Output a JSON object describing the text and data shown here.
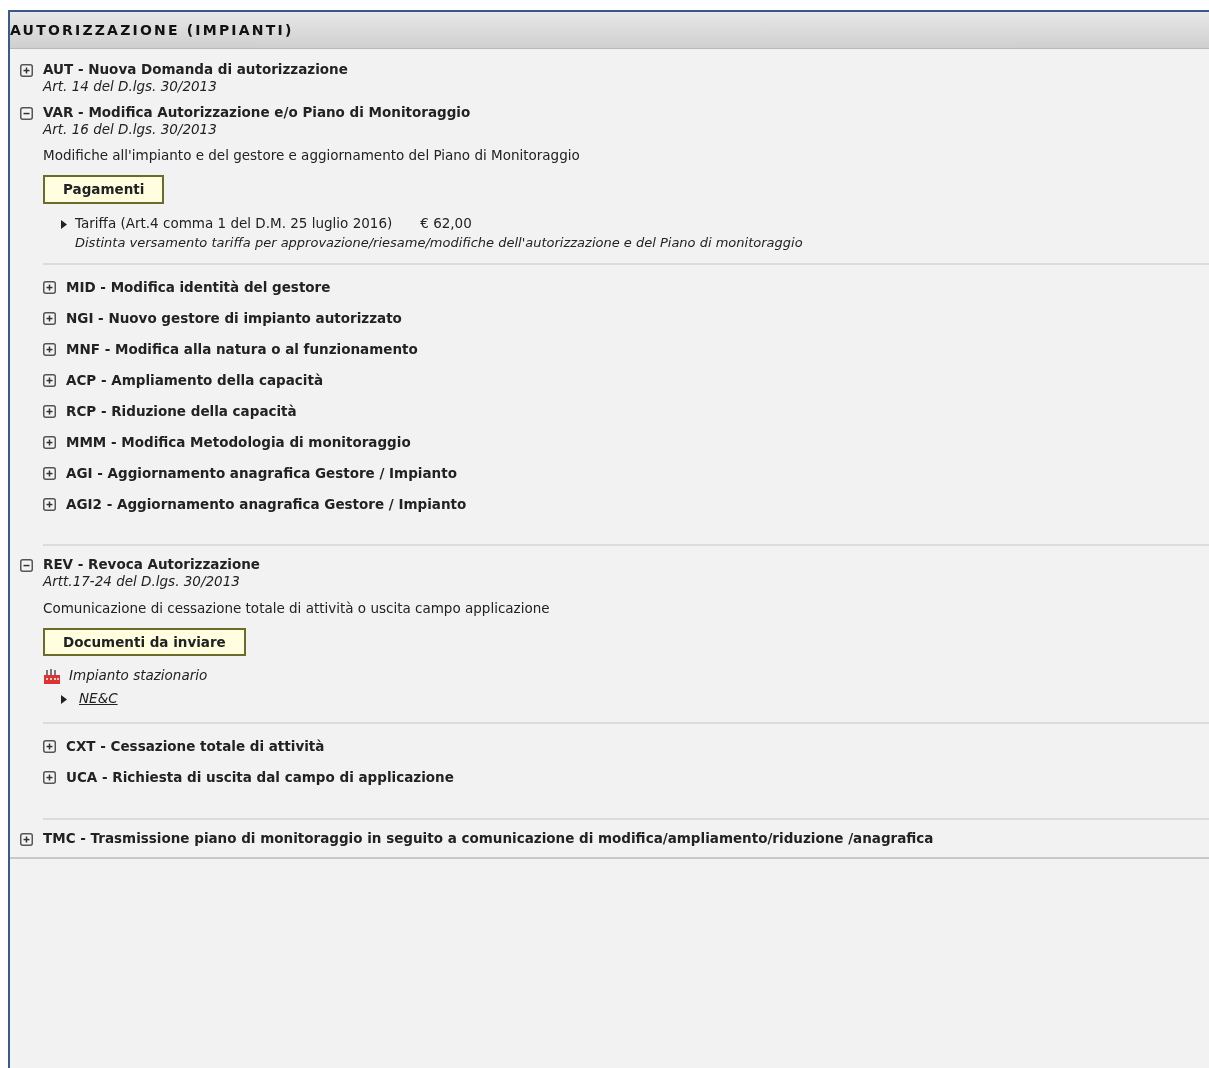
{
  "header": {
    "title": "AUTORIZZAZIONE (IMPIANTI)"
  },
  "procedures": [
    {
      "title": "AUT - Nuova Domanda di autorizzazione",
      "reference": "Art. 14 del D.lgs. 30/2013",
      "expanded": false
    },
    {
      "title": "VAR - Modifica Autorizzazione e/o Piano di Monitoraggio",
      "reference": "Art. 16 del D.lgs. 30/2013",
      "expanded": true,
      "description": "Modifiche all'impianto e del gestore e aggiornamento del Piano di Monitoraggio",
      "section": {
        "label": "Pagamenti",
        "items": [
          {
            "kind": "fee",
            "label": "Tariffa (Art.4 comma 1 del D.M. 25 luglio 2016)",
            "amount": "€ 62,00",
            "note": "Distinta versamento tariffa per approvazione/riesame/modifiche dell'autorizzazione e del Piano di monitoraggio"
          }
        ]
      },
      "children": [
        {
          "title": "MID - Modifica identità del gestore",
          "expanded": false
        },
        {
          "title": "NGI - Nuovo gestore di impianto autorizzato",
          "expanded": false
        },
        {
          "title": "MNF - Modifica alla natura o al funzionamento",
          "expanded": false
        },
        {
          "title": "ACP - Ampliamento della capacità",
          "expanded": false
        },
        {
          "title": "RCP - Riduzione della capacità",
          "expanded": false
        },
        {
          "title": "MMM - Modifica Metodologia di monitoraggio",
          "expanded": false
        },
        {
          "title": "AGI - Aggiornamento anagrafica Gestore / Impianto",
          "expanded": false
        },
        {
          "title": "AGI2 - Aggiornamento anagrafica Gestore / Impianto",
          "expanded": false
        }
      ]
    },
    {
      "title": "REV - Revoca Autorizzazione",
      "reference": "Artt.17-24 del D.lgs. 30/2013",
      "expanded": true,
      "description": "Comunicazione di cessazione totale di attività o uscita campo applicazione",
      "section": {
        "label": "Documenti da inviare",
        "items": [
          {
            "kind": "category",
            "label": "Impianto stazionario"
          },
          {
            "kind": "link",
            "label": "NE&C"
          }
        ]
      },
      "children": [
        {
          "title": "CXT - Cessazione totale di attività",
          "expanded": false
        },
        {
          "title": "UCA - Richiesta di uscita dal campo di applicazione",
          "expanded": false
        }
      ]
    },
    {
      "title": "TMC - Trasmissione piano di monitoraggio in seguito a comunicazione di modifica/ampliamento/riduzione /anagrafica",
      "expanded": false
    }
  ]
}
